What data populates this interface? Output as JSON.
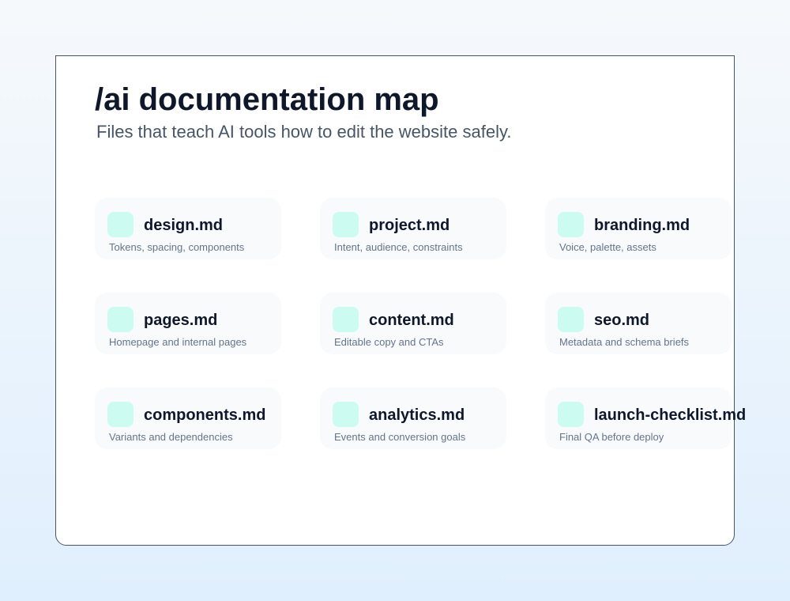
{
  "header": {
    "title": "/ai documentation map",
    "subtitle": "Files that teach AI tools how to edit the website safely."
  },
  "files": [
    {
      "name": "design.md",
      "description": "Tokens, spacing, components",
      "icon": "file-icon"
    },
    {
      "name": "project.md",
      "description": "Intent, audience, constraints",
      "icon": "file-icon"
    },
    {
      "name": "branding.md",
      "description": "Voice, palette, assets",
      "icon": "file-icon"
    },
    {
      "name": "pages.md",
      "description": "Homepage and internal pages",
      "icon": "file-icon"
    },
    {
      "name": "content.md",
      "description": "Editable copy and CTAs",
      "icon": "file-icon"
    },
    {
      "name": "seo.md",
      "description": "Metadata and schema briefs",
      "icon": "file-icon"
    },
    {
      "name": "components.md",
      "description": "Variants and dependencies",
      "icon": "file-icon"
    },
    {
      "name": "analytics.md",
      "description": "Events and conversion goals",
      "icon": "file-icon"
    },
    {
      "name": "launch-checklist.md",
      "description": "Final QA before deploy",
      "icon": "file-icon"
    }
  ],
  "colors": {
    "icon_tile": "#ccfbf1",
    "card_background": "#f8fafc",
    "title_text": "#0f172a",
    "subtitle_text": "#475569",
    "description_text": "#64748b"
  }
}
